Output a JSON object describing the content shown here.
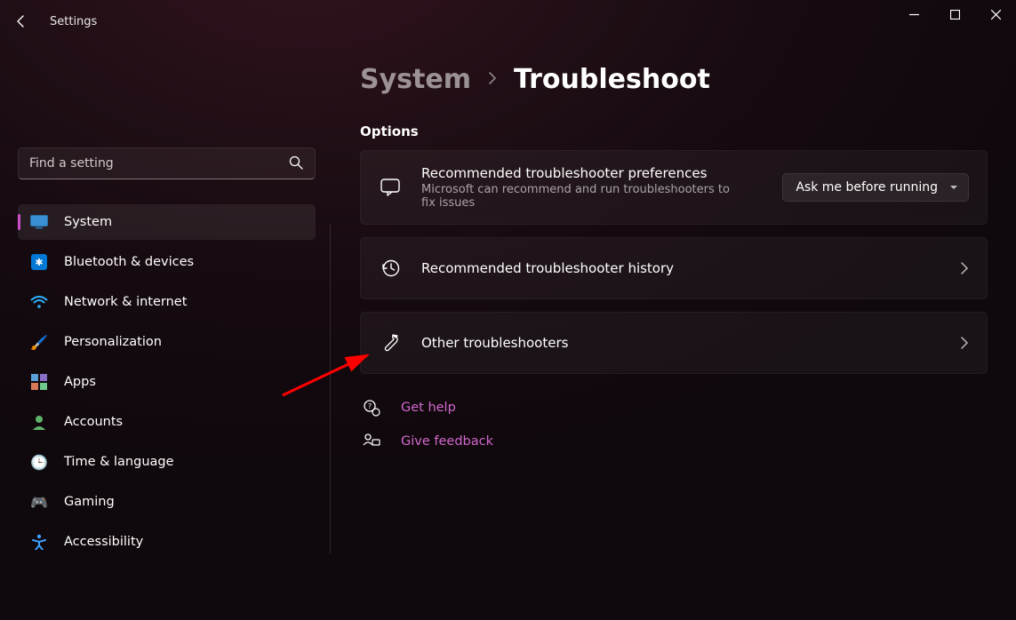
{
  "app": {
    "title": "Settings"
  },
  "search": {
    "placeholder": "Find a setting"
  },
  "sidebar": {
    "items": [
      {
        "label": "System"
      },
      {
        "label": "Bluetooth & devices"
      },
      {
        "label": "Network & internet"
      },
      {
        "label": "Personalization"
      },
      {
        "label": "Apps"
      },
      {
        "label": "Accounts"
      },
      {
        "label": "Time & language"
      },
      {
        "label": "Gaming"
      },
      {
        "label": "Accessibility"
      }
    ]
  },
  "breadcrumb": {
    "parent": "System",
    "leaf": "Troubleshoot"
  },
  "section": {
    "options": "Options"
  },
  "cards": {
    "pref": {
      "title": "Recommended troubleshooter preferences",
      "subtitle": "Microsoft can recommend and run troubleshooters to fix issues",
      "dropdown": "Ask me before running"
    },
    "history": {
      "title": "Recommended troubleshooter history"
    },
    "other": {
      "title": "Other troubleshooters"
    }
  },
  "help": {
    "gethelp": "Get help",
    "feedback": "Give feedback"
  }
}
